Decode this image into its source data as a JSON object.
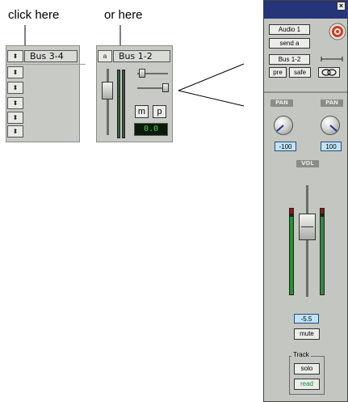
{
  "captions": {
    "left": "click here",
    "middle": "or here"
  },
  "left_strip": {
    "send_slot_name": "Bus 3-4",
    "slot_arrows": [
      "⬍",
      "⬍",
      "⬍",
      "⬍",
      "⬍"
    ]
  },
  "middle_strip": {
    "send_slot_letter": "a",
    "send_slot_name": "Bus 1-2",
    "mute_label": "m",
    "pre_label": "p",
    "level_readout": "0.0"
  },
  "send_window": {
    "close_glyph": "×",
    "track_name": "Audio 1",
    "send_name": "send a",
    "output_bus": "Bus 1-2",
    "pre_label": "pre",
    "safe_label": "safe",
    "pan_left_label": "PAN",
    "pan_right_label": "PAN",
    "pan_left_value": "-100",
    "pan_right_value": "100",
    "vol_label": "VOL",
    "volume_value": "-5.5",
    "mute_label": "mute",
    "track_group_label": "Track",
    "solo_label": "solo",
    "automation_mode": "read"
  },
  "colors": {
    "titlebar": "#26347a",
    "meter_green": "#2f8a3a",
    "meter_peak": "#8a1a14",
    "value_box": "#bfe3f7",
    "readout_text": "#3bd44a",
    "read_text": "#1f8a2a"
  }
}
